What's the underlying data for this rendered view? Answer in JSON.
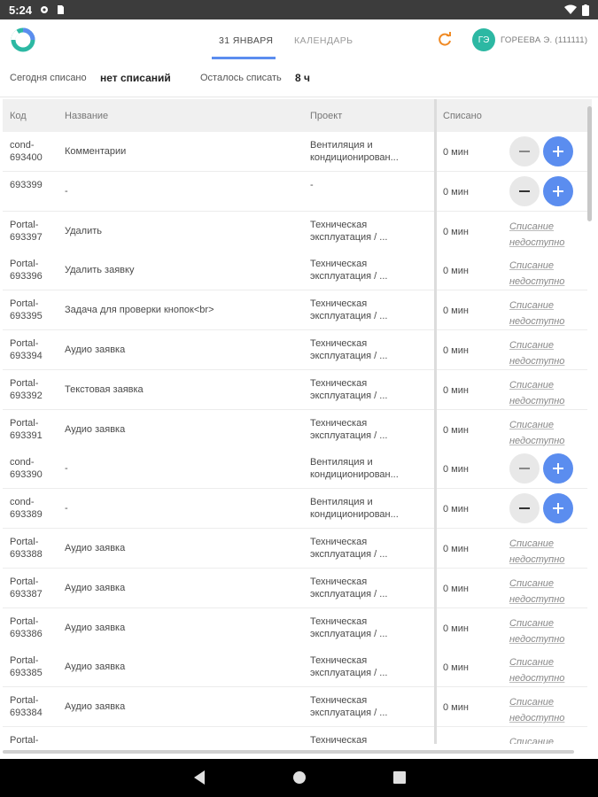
{
  "status_bar": {
    "time": "5:24"
  },
  "header": {
    "tabs": [
      {
        "label": "31 ЯНВАРЯ",
        "active": true
      },
      {
        "label": "КАЛЕНДАРЬ",
        "active": false
      }
    ],
    "avatar_initials": "ГЭ",
    "user_name": "ГОРЕЕВА Э. (111111)"
  },
  "summary": {
    "today_label": "Сегодня списано",
    "today_value": "нет списаний",
    "remaining_label": "Осталось списать",
    "remaining_value": "8 ч"
  },
  "table": {
    "headers": {
      "code": "Код",
      "name": "Название",
      "project": "Проект",
      "logged": "Списано"
    },
    "unavailable_label_1": "Списание",
    "unavailable_label_2": "недоступно",
    "rows": [
      {
        "code": "cond-693400",
        "name": "Комментарии",
        "project": "Вентиляция и кондиционирован...",
        "time": "0 мин",
        "can_log": true
      },
      {
        "code": "693399",
        "name": "-",
        "project": "-",
        "time": "0 мин",
        "can_log": true
      },
      {
        "code": "Portal-693397",
        "name": "Удалить",
        "project": "Техническая эксплуатация / ...",
        "time": "0 мин",
        "can_log": false
      },
      {
        "code": "Portal-693396",
        "name": "Удалить заявку",
        "project": "Техническая эксплуатация / ...",
        "time": "0 мин",
        "can_log": false
      },
      {
        "code": "Portal-693395",
        "name": "Задача для проверки кнопок<br>",
        "project": "Техническая эксплуатация / ...",
        "time": "0 мин",
        "can_log": false
      },
      {
        "code": "Portal-693394",
        "name": "Аудио заявка",
        "project": "Техническая эксплуатация / ...",
        "time": "0 мин",
        "can_log": false
      },
      {
        "code": "Portal-693392",
        "name": "Текстовая заявка",
        "project": "Техническая эксплуатация / ...",
        "time": "0 мин",
        "can_log": false
      },
      {
        "code": "Portal-693391",
        "name": "Аудио заявка",
        "project": "Техническая эксплуатация / ...",
        "time": "0 мин",
        "can_log": false
      },
      {
        "code": "cond-693390",
        "name": "-",
        "project": "Вентиляция и кондиционирован...",
        "time": "0 мин",
        "can_log": true
      },
      {
        "code": "cond-693389",
        "name": "-",
        "project": "Вентиляция и кондиционирован...",
        "time": "0 мин",
        "can_log": true
      },
      {
        "code": "Portal-693388",
        "name": "Аудио заявка",
        "project": "Техническая эксплуатация / ...",
        "time": "0 мин",
        "can_log": false
      },
      {
        "code": "Portal-693387",
        "name": "Аудио заявка",
        "project": "Техническая эксплуатация / ...",
        "time": "0 мин",
        "can_log": false
      },
      {
        "code": "Portal-693386",
        "name": "Аудио заявка",
        "project": "Техническая эксплуатация / ...",
        "time": "0 мин",
        "can_log": false
      },
      {
        "code": "Portal-693385",
        "name": "Аудио заявка",
        "project": "Техническая эксплуатация / ...",
        "time": "0 мин",
        "can_log": false
      },
      {
        "code": "Portal-693384",
        "name": "Аудио заявка",
        "project": "Техническая эксплуатация / ...",
        "time": "0 мин",
        "can_log": false
      },
      {
        "code": "Portal-",
        "name": "-",
        "project": "Техническая",
        "time": "",
        "can_log": false
      }
    ]
  },
  "colors": {
    "accent": "#5b8def",
    "avatar": "#2cb8a3",
    "refresh": "#f08a24"
  }
}
